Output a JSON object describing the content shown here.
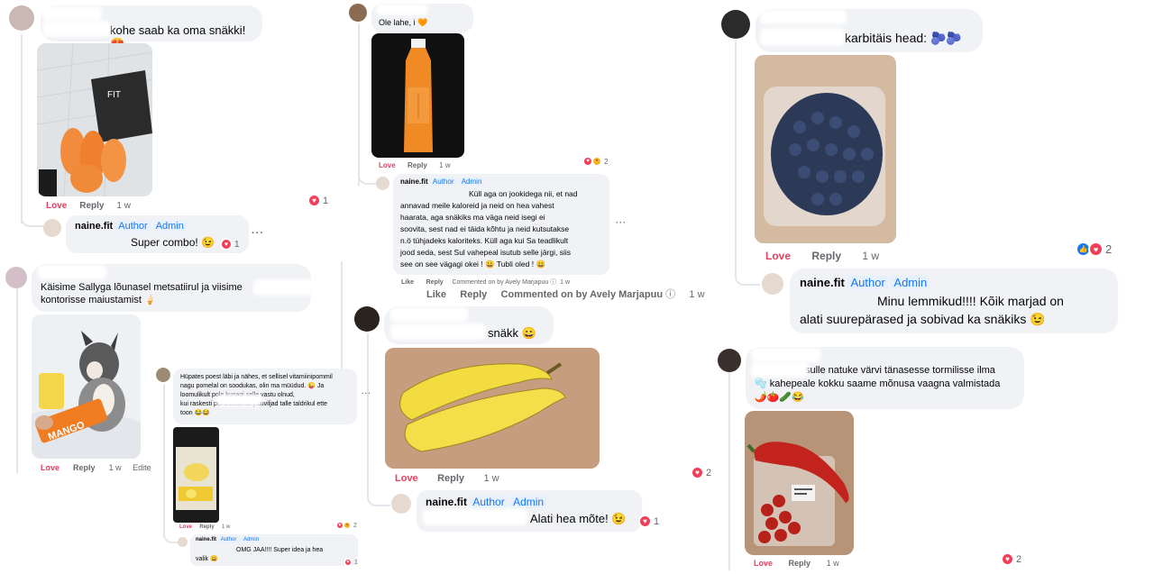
{
  "labels": {
    "love": "Love",
    "like": "Like",
    "reply": "Reply",
    "author": "Author",
    "admin": "Admin",
    "more": "···"
  },
  "c1": {
    "text": "kohe saab ka oma snäkki! 😍",
    "time": "1 w",
    "reactions": "1",
    "reply": {
      "name": "naine.fit",
      "text": "Super combo! 😉",
      "reactions": "1"
    }
  },
  "c2": {
    "text": "Käisime Sallyga lõunasel metsatiirul ja viisime\nkontorisse maiustamist 🍦",
    "time": "1 w",
    "edited": "Edite"
  },
  "c3": {
    "text": "Hüpates poest läbi ja nähes, et sellisel vitamiinipommil\nnagu pomelal on soodukas, olin ma müüdud. 😜 Ja\nloomulikult              pole kunagi selle vastu olnud,\nkui raskesti puhastatavad puuviljad talle taldrikul ette\ntoon 😂😂",
    "time": "1 w",
    "reactions": "2",
    "reply": {
      "name": "naine.fit",
      "text": "OMG JAA!!!! Super idea ja hea\nvalik 😀",
      "reactions": "1"
    }
  },
  "c4": {
    "text": "Ole lahe, i          🧡",
    "time": "1 w",
    "reactions": "2",
    "reply": {
      "name": "naine.fit",
      "text": "Küll aga on jookidega nii, et nad\nannavad meile kaloreid ja neid on hea vahest\nhaarata, aga snäkiks ma väga neid isegi ei\nsoovita, sest nad ei täida kõhtu ja neid kutsutakse\nn.ö tühjadeks kaloriteks. Küll aga kui Sa teadlikult\njood seda, sest Sul vahepeal isutub selle järgi, siis\nsee on see vägagi okei ! 😀 Tubli oled ! 😀",
      "commented_small": "Commented on by Avely Marjapuu",
      "commented_large": "Commented on by Avely Marjapuu",
      "time": "1 w"
    }
  },
  "c5": {
    "text": "snäkk 😀",
    "time": "1 w",
    "reactions": "2",
    "reply": {
      "name": "naine.fit",
      "text": "Alati hea mõte! 😉",
      "reactions": "1"
    }
  },
  "c6": {
    "text": "karbitäis head: 🫐🫐",
    "time": "1 w",
    "reactions": "2",
    "reply": {
      "name": "naine.fit",
      "text": "Minu lemmikud!!!! Kõik marjad on\nalati suurepärased ja sobivad ka snäkiks 😉"
    }
  },
  "c7": {
    "text": "sulle natuke värvi tänasesse tormilisse ilma\n🫧 kahepeale kokku saame mõnusa vaagna valmistada\n🌶️🍅🥒😂",
    "time": "1 w",
    "reactions": "2"
  }
}
